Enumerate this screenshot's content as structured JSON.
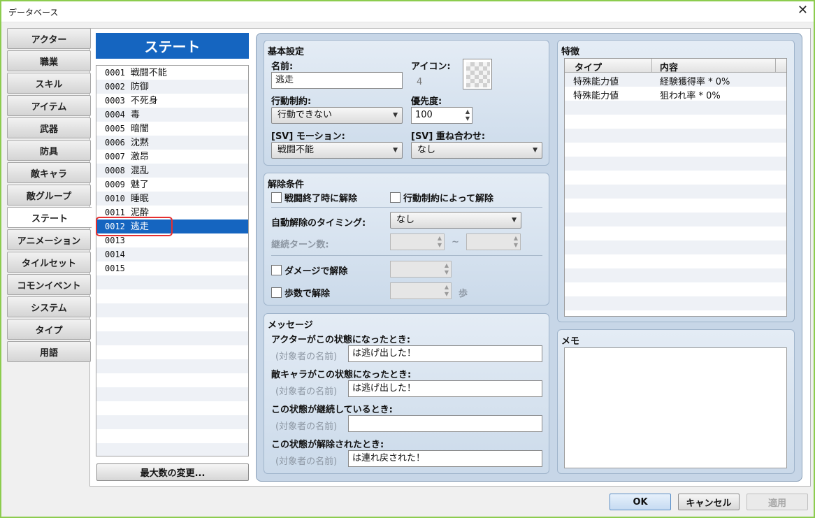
{
  "window": {
    "title": "データベース"
  },
  "tabs": [
    {
      "label": "アクター",
      "selected": false
    },
    {
      "label": "職業",
      "selected": false
    },
    {
      "label": "スキル",
      "selected": false
    },
    {
      "label": "アイテム",
      "selected": false
    },
    {
      "label": "武器",
      "selected": false
    },
    {
      "label": "防具",
      "selected": false
    },
    {
      "label": "敵キャラ",
      "selected": false
    },
    {
      "label": "敵グループ",
      "selected": false
    },
    {
      "label": "ステート",
      "selected": true
    },
    {
      "label": "アニメーション",
      "selected": false
    },
    {
      "label": "タイルセット",
      "selected": false
    },
    {
      "label": "コモンイベント",
      "selected": false
    },
    {
      "label": "システム",
      "selected": false
    },
    {
      "label": "タイプ",
      "selected": false
    },
    {
      "label": "用語",
      "selected": false
    }
  ],
  "list": {
    "header": "ステート",
    "items": [
      {
        "id": "0001",
        "name": "戦闘不能"
      },
      {
        "id": "0002",
        "name": "防御"
      },
      {
        "id": "0003",
        "name": "不死身"
      },
      {
        "id": "0004",
        "name": "毒"
      },
      {
        "id": "0005",
        "name": "暗闇"
      },
      {
        "id": "0006",
        "name": "沈黙"
      },
      {
        "id": "0007",
        "name": "激昂"
      },
      {
        "id": "0008",
        "name": "混乱"
      },
      {
        "id": "0009",
        "name": "魅了"
      },
      {
        "id": "0010",
        "name": "睡眠"
      },
      {
        "id": "0011",
        "name": "泥酔"
      },
      {
        "id": "0012",
        "name": "逃走"
      },
      {
        "id": "0013",
        "name": ""
      },
      {
        "id": "0014",
        "name": ""
      },
      {
        "id": "0015",
        "name": ""
      }
    ],
    "selected_index": 11,
    "max_button": "最大数の変更..."
  },
  "basic": {
    "title": "基本設定",
    "name_label": "名前:",
    "name_value": "逃走",
    "icon_label": "アイコン:",
    "icon_index": "4",
    "restriction_label": "行動制約:",
    "restriction_value": "行動できない",
    "priority_label": "優先度:",
    "priority_value": "100",
    "motion_label": "[SV] モーション:",
    "motion_value": "戦闘不能",
    "overlay_label": "[SV] 重ね合わせ:",
    "overlay_value": "なし"
  },
  "removal": {
    "title": "解除条件",
    "battle_end": "戦闘終了時に解除",
    "by_restriction": "行動制約によって解除",
    "auto_timing_label": "自動解除のタイミング:",
    "auto_timing_value": "なし",
    "duration_label": "継続ターン数:",
    "tilde": "~",
    "by_damage": "ダメージで解除",
    "by_walking": "歩数で解除",
    "steps_unit": "歩"
  },
  "messages": {
    "title": "メッセージ",
    "target_hint": "(対象者の名前)",
    "actor_label": "アクターがこの状態になったとき:",
    "actor_value": "は逃げ出した！",
    "enemy_label": "敵キャラがこの状態になったとき:",
    "enemy_value": "は逃げ出した！",
    "persist_label": "この状態が継続しているとき:",
    "persist_value": "",
    "remove_label": "この状態が解除されたとき:",
    "remove_value": "は連れ戻された！"
  },
  "traits": {
    "title": "特徴",
    "col_type": "タイプ",
    "col_content": "内容",
    "rows": [
      {
        "type": "特殊能力値",
        "content": "経験獲得率 * 0%"
      },
      {
        "type": "特殊能力値",
        "content": "狙われ率 * 0%"
      }
    ]
  },
  "memo": {
    "title": "メモ",
    "value": ""
  },
  "footer": {
    "ok": "OK",
    "cancel": "キャンセル",
    "apply": "適用"
  }
}
